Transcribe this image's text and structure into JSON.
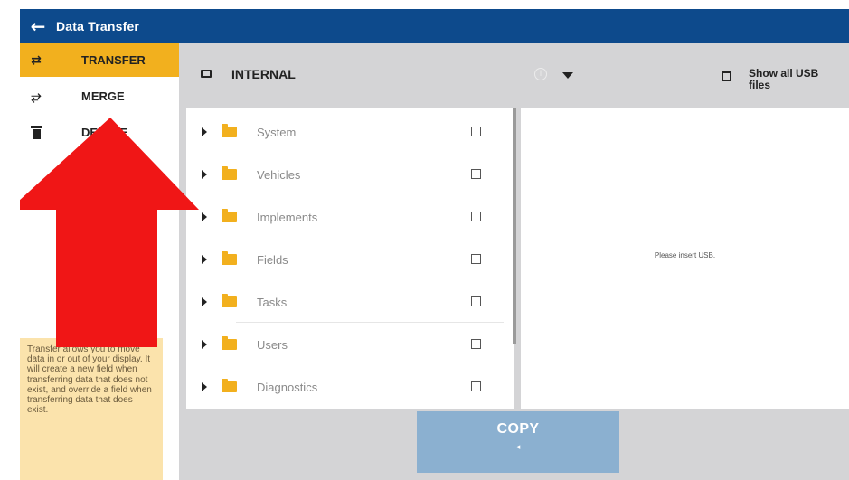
{
  "titlebar": {
    "back_icon": "←",
    "title": "Data Transfer"
  },
  "sidebar": {
    "items": [
      {
        "icon": "transfer-icon",
        "glyph": "⇄",
        "label": "TRANSFER",
        "active": true
      },
      {
        "icon": "merge-icon",
        "glyph": "⥂",
        "label": "MERGE",
        "active": false
      },
      {
        "icon": "delete-icon",
        "label": "DELETE",
        "visible_label": "ETE",
        "active": false
      }
    ],
    "help_text": "Transfer allows you to move data in or out of your display. It will create a new field when transferring data that does not exist, and override a field when transferring data that does exist."
  },
  "header": {
    "storage_label": "INTERNAL",
    "show_usb_label": "Show all USB files",
    "info_icon": "i"
  },
  "folders": [
    {
      "name": "System"
    },
    {
      "name": "Vehicles"
    },
    {
      "name": "Implements"
    },
    {
      "name": "Fields"
    },
    {
      "name": "Tasks"
    },
    {
      "name": "Users"
    },
    {
      "name": "Diagnostics"
    }
  ],
  "usb_panel": {
    "message": "Please insert USB."
  },
  "copy_button": {
    "label": "COPY",
    "arrow": "◂"
  },
  "colors": {
    "titlebar": "#0d4a8c",
    "accent": "#f2b01e",
    "help_box": "#fbe3ac",
    "copy_button": "#8bb0d0",
    "red_arrow": "#f01616"
  }
}
